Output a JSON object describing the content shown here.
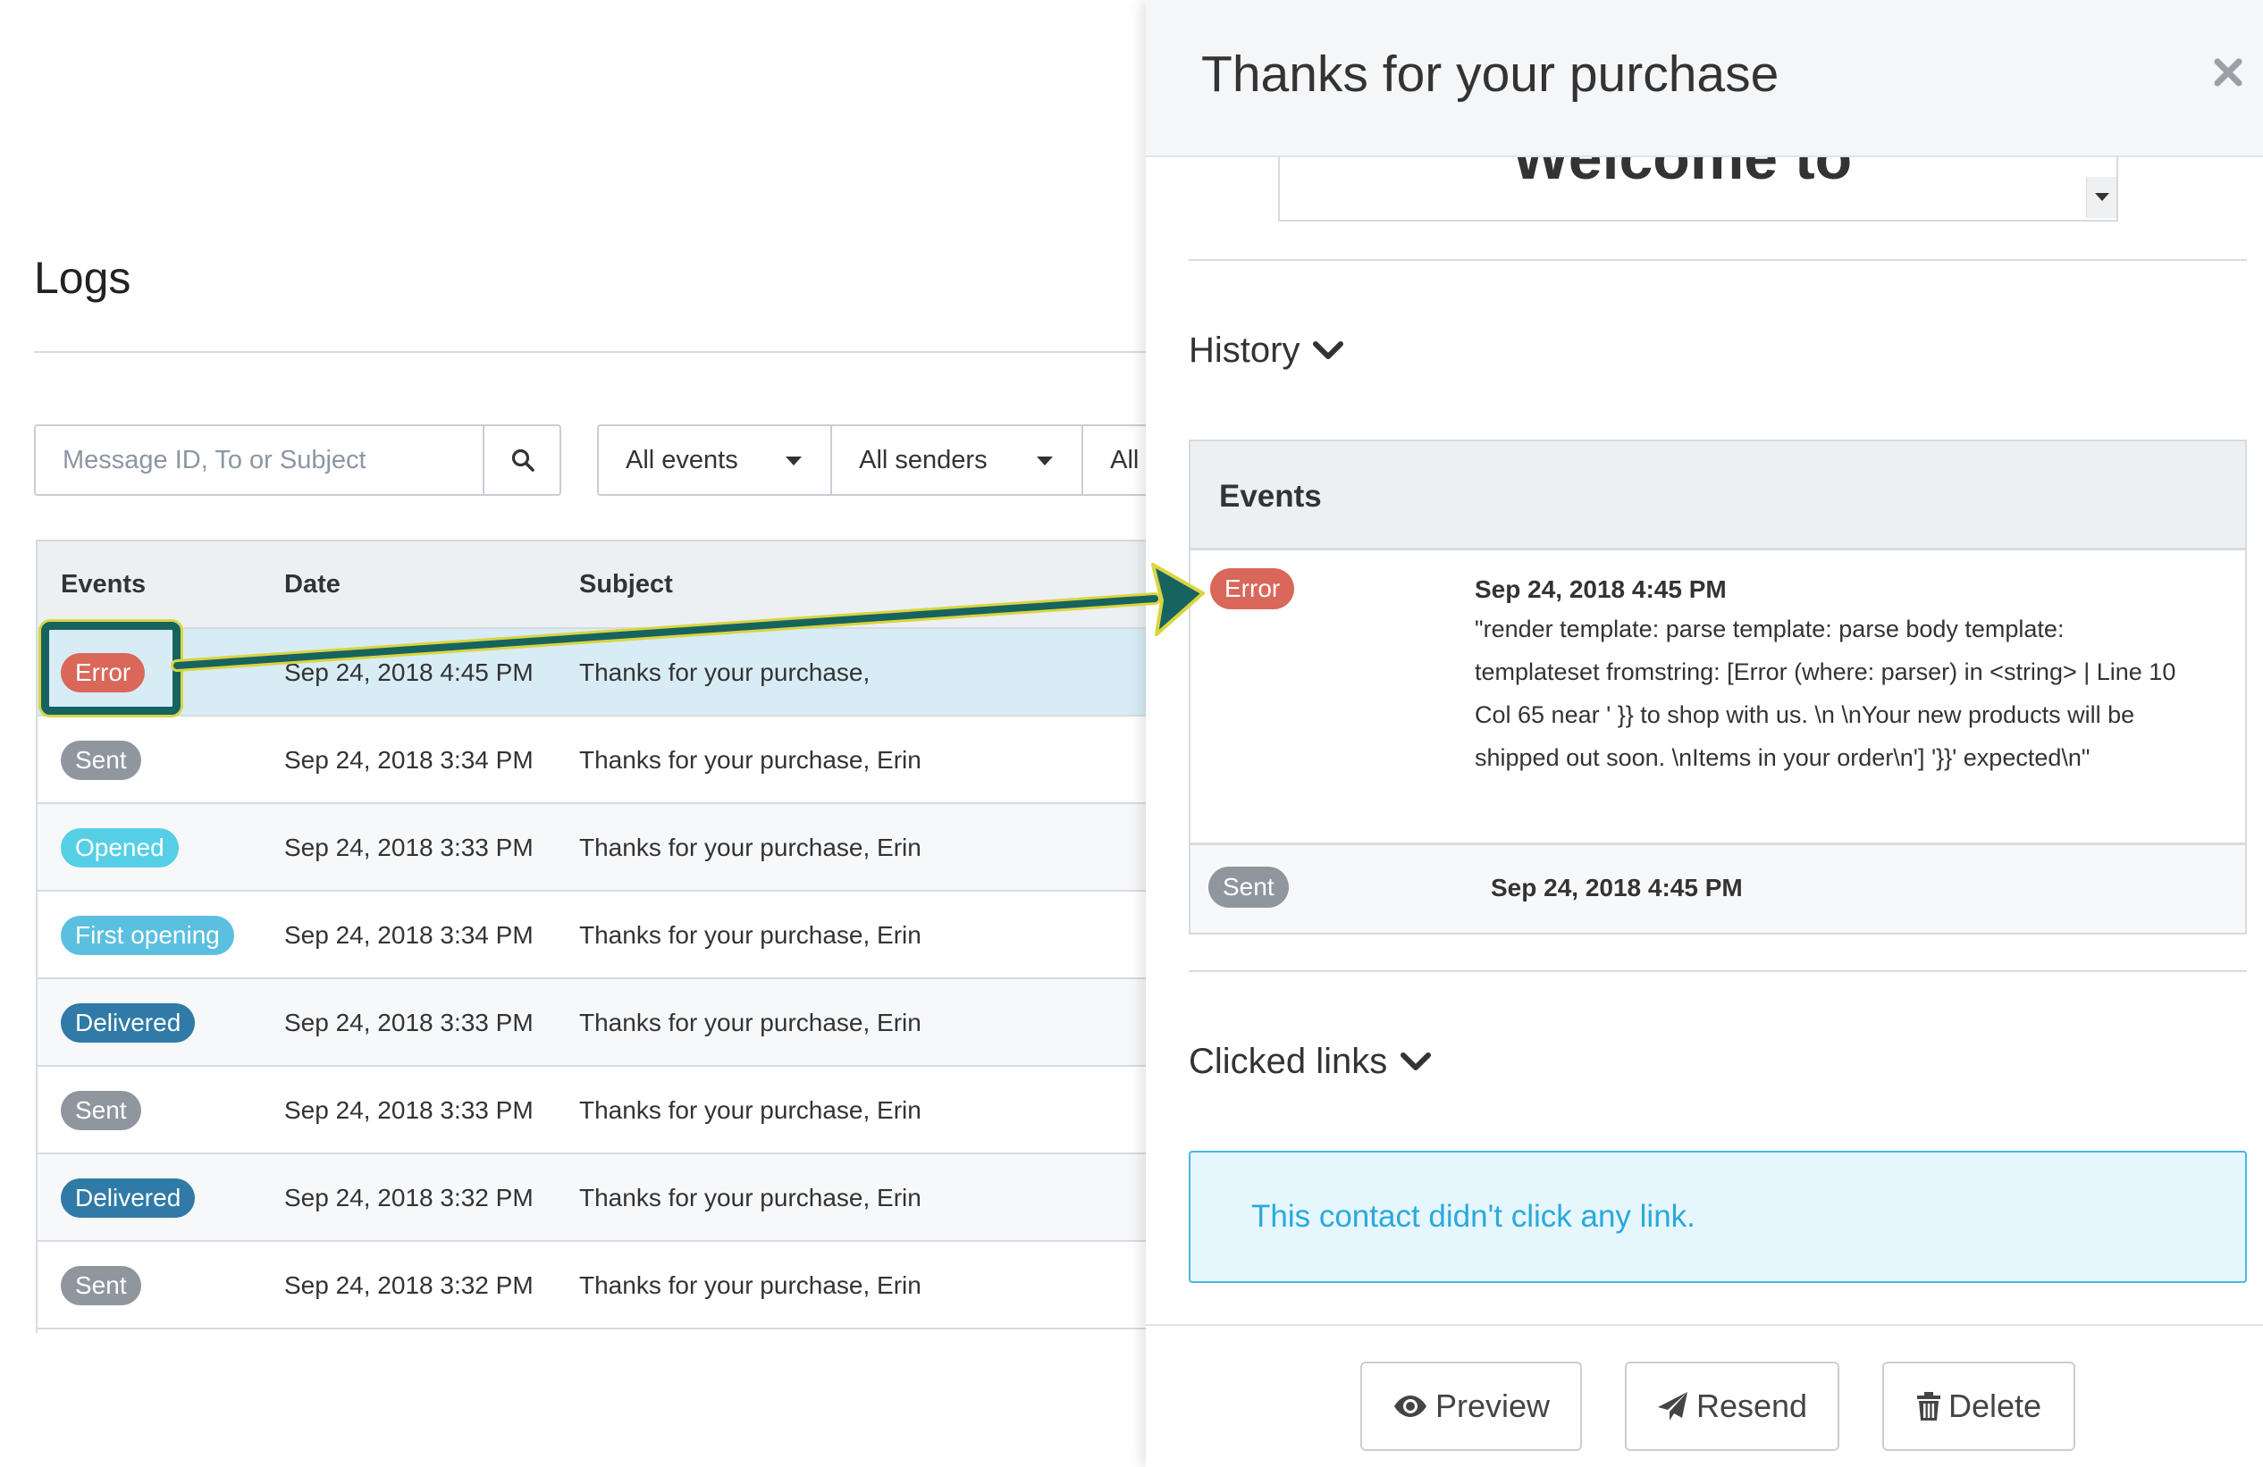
{
  "logs": {
    "title": "Logs",
    "search": {
      "placeholder": "Message ID, To or Subject",
      "value": ""
    },
    "filters": [
      {
        "label": "All events"
      },
      {
        "label": "All senders"
      },
      {
        "label": "All"
      }
    ],
    "table": {
      "headers": {
        "events": "Events",
        "date": "Date",
        "subject": "Subject"
      },
      "rows": [
        {
          "event": "Error",
          "event_color": "#d9675a",
          "date": "Sep 24, 2018 4:45 PM",
          "subject": "Thanks for your purchase,"
        },
        {
          "event": "Sent",
          "event_color": "#8f969e",
          "date": "Sep 24, 2018 3:34 PM",
          "subject": "Thanks for your purchase, Erin"
        },
        {
          "event": "Opened",
          "event_color": "#56cfe6",
          "date": "Sep 24, 2018 3:33 PM",
          "subject": "Thanks for your purchase, Erin"
        },
        {
          "event": "First opening",
          "event_color": "#5bbfe0",
          "date": "Sep 24, 2018 3:34 PM",
          "subject": "Thanks for your purchase, Erin"
        },
        {
          "event": "Delivered",
          "event_color": "#2f7aa6",
          "date": "Sep 24, 2018 3:33 PM",
          "subject": "Thanks for your purchase, Erin"
        },
        {
          "event": "Sent",
          "event_color": "#8f969e",
          "date": "Sep 24, 2018 3:33 PM",
          "subject": "Thanks for your purchase, Erin"
        },
        {
          "event": "Delivered",
          "event_color": "#2f7aa6",
          "date": "Sep 24, 2018 3:32 PM",
          "subject": "Thanks for your purchase, Erin"
        },
        {
          "event": "Sent",
          "event_color": "#8f969e",
          "date": "Sep 24, 2018 3:32 PM",
          "subject": "Thanks for your purchase, Erin"
        }
      ]
    }
  },
  "panel": {
    "title": "Thanks for your purchase",
    "email_preview_text": "Welcome to",
    "history_label": "History",
    "events": {
      "header": "Events",
      "items": [
        {
          "event": "Error",
          "date": "Sep 24, 2018 4:45 PM",
          "message": "\"render template: parse template: parse body template: templateset fromstring: [Error (where: parser) in <string> | Line 10 Col 65 near ' }} to shop with us. \\n \\nYour new products will be shipped out soon.   \\nItems in your order\\n'] '}}' expected\\n\""
        },
        {
          "event": "Sent",
          "date": "Sep 24, 2018 4:45 PM"
        }
      ]
    },
    "clicked_links_label": "Clicked links",
    "no_links_message": "This contact didn't click any link.",
    "buttons": {
      "preview": "Preview",
      "resend": "Resend",
      "delete": "Delete"
    }
  },
  "colors": {
    "annotation_arrow": "#17635f",
    "annotation_outline": "#d9d540",
    "selected_row": "#d8ecf6",
    "info_text": "#2aa9dc"
  }
}
